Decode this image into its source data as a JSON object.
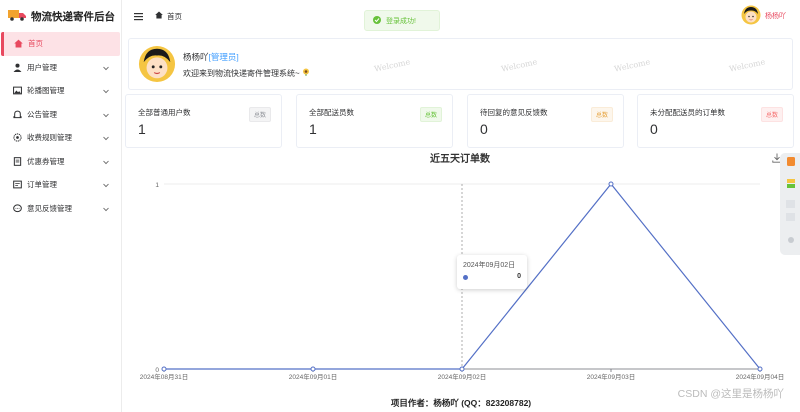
{
  "brand": {
    "title": "物流快递寄件后台"
  },
  "sidebar": {
    "items": [
      {
        "label": "首页",
        "icon": "home-icon",
        "active": true
      },
      {
        "label": "用户管理",
        "icon": "user-icon",
        "has_children": true
      },
      {
        "label": "轮播图管理",
        "icon": "image-icon",
        "has_children": true
      },
      {
        "label": "公告管理",
        "icon": "bell-icon",
        "has_children": true
      },
      {
        "label": "收费规则管理",
        "icon": "gear-icon",
        "has_children": true
      },
      {
        "label": "优惠券管理",
        "icon": "document-icon",
        "has_children": true
      },
      {
        "label": "订单管理",
        "icon": "order-icon",
        "has_children": true
      },
      {
        "label": "意见反馈管理",
        "icon": "chat-icon",
        "has_children": true
      }
    ]
  },
  "header": {
    "breadcrumb": "首页",
    "user_name": "杨杨吖"
  },
  "toast": {
    "text": "登录成功!"
  },
  "welcome": {
    "name": "杨杨吖",
    "role": "[管理员]",
    "message": "欢迎来到物流快递寄件管理系统~",
    "watermark": "Welcome"
  },
  "stats": [
    {
      "label": "全部普通用户数",
      "value": "1",
      "tag": "总数",
      "tag_color": "#909399"
    },
    {
      "label": "全部配送员数",
      "value": "1",
      "tag": "总数",
      "tag_color": "#67c23a"
    },
    {
      "label": "待回复的意见反馈数",
      "value": "0",
      "tag": "总数",
      "tag_color": "#e6a23c"
    },
    {
      "label": "未分配配送员的订单数",
      "value": "0",
      "tag": "总数",
      "tag_color": "#f56c6c"
    }
  ],
  "chart_data": {
    "type": "line",
    "title": "近五天订单数",
    "categories": [
      "2024年08月31日",
      "2024年09月01日",
      "2024年09月02日",
      "2024年09月03日",
      "2024年09月04日"
    ],
    "series": [
      {
        "values": [
          0,
          0,
          0,
          1,
          0
        ]
      }
    ],
    "ylim": [
      0,
      1
    ],
    "yticks": [
      "0",
      "1"
    ],
    "color": "#5470c6",
    "tooltip": {
      "date": "2024年09月02日",
      "value": "0"
    }
  },
  "footer": {
    "text": "项目作者：杨杨吖 (QQ：823208782)"
  },
  "watermark_text": "CSDN @这里是杨杨吖"
}
